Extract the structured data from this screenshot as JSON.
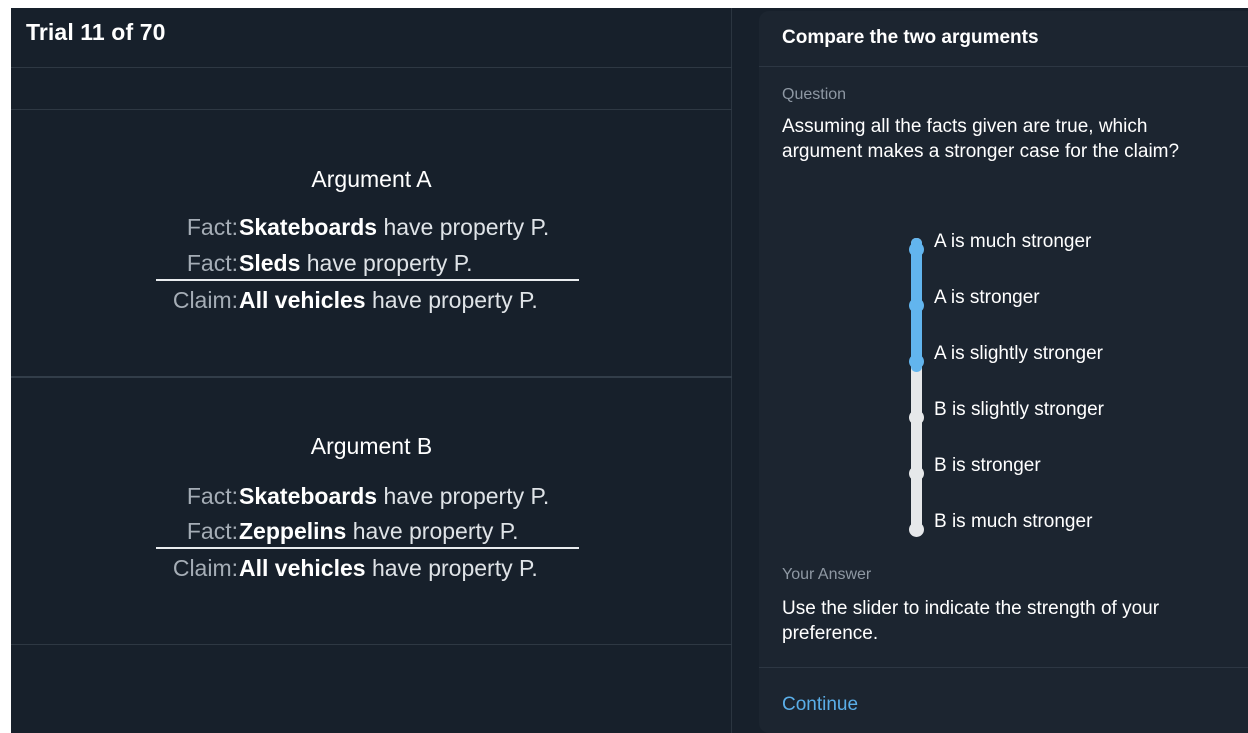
{
  "trial": {
    "title": "Trial 11 of 70"
  },
  "arguments": [
    {
      "title": "Argument A",
      "facts": [
        {
          "label": "Fact:",
          "subject": "Skateboards",
          "rest": "have property P."
        },
        {
          "label": "Fact:",
          "subject": "Sleds",
          "rest": "have property P."
        }
      ],
      "claim": {
        "label": "Claim:",
        "subject": "All vehicles",
        "rest": "have property P."
      }
    },
    {
      "title": "Argument B",
      "facts": [
        {
          "label": "Fact:",
          "subject": "Skateboards",
          "rest": "have property P."
        },
        {
          "label": "Fact:",
          "subject": "Zeppelins",
          "rest": "have property P."
        }
      ],
      "claim": {
        "label": "Claim:",
        "subject": "All vehicles",
        "rest": "have property P."
      }
    }
  ],
  "panel": {
    "title": "Compare the two arguments",
    "question_label": "Question",
    "question": "Assuming all the facts given are true, which argument makes a stronger case for the claim?",
    "answer_label": "Your Answer",
    "answer_text": "Use the slider to indicate the strength of your preference.",
    "continue_label": "Continue"
  },
  "slider": {
    "options": [
      "A is much stronger",
      "A is stronger",
      "A is slightly stronger",
      "B is slightly stronger",
      "B is stronger",
      "B is much stronger"
    ],
    "selected_index": 2,
    "active_color": "#62b5ee",
    "inactive_color": "#e6e8ea"
  }
}
